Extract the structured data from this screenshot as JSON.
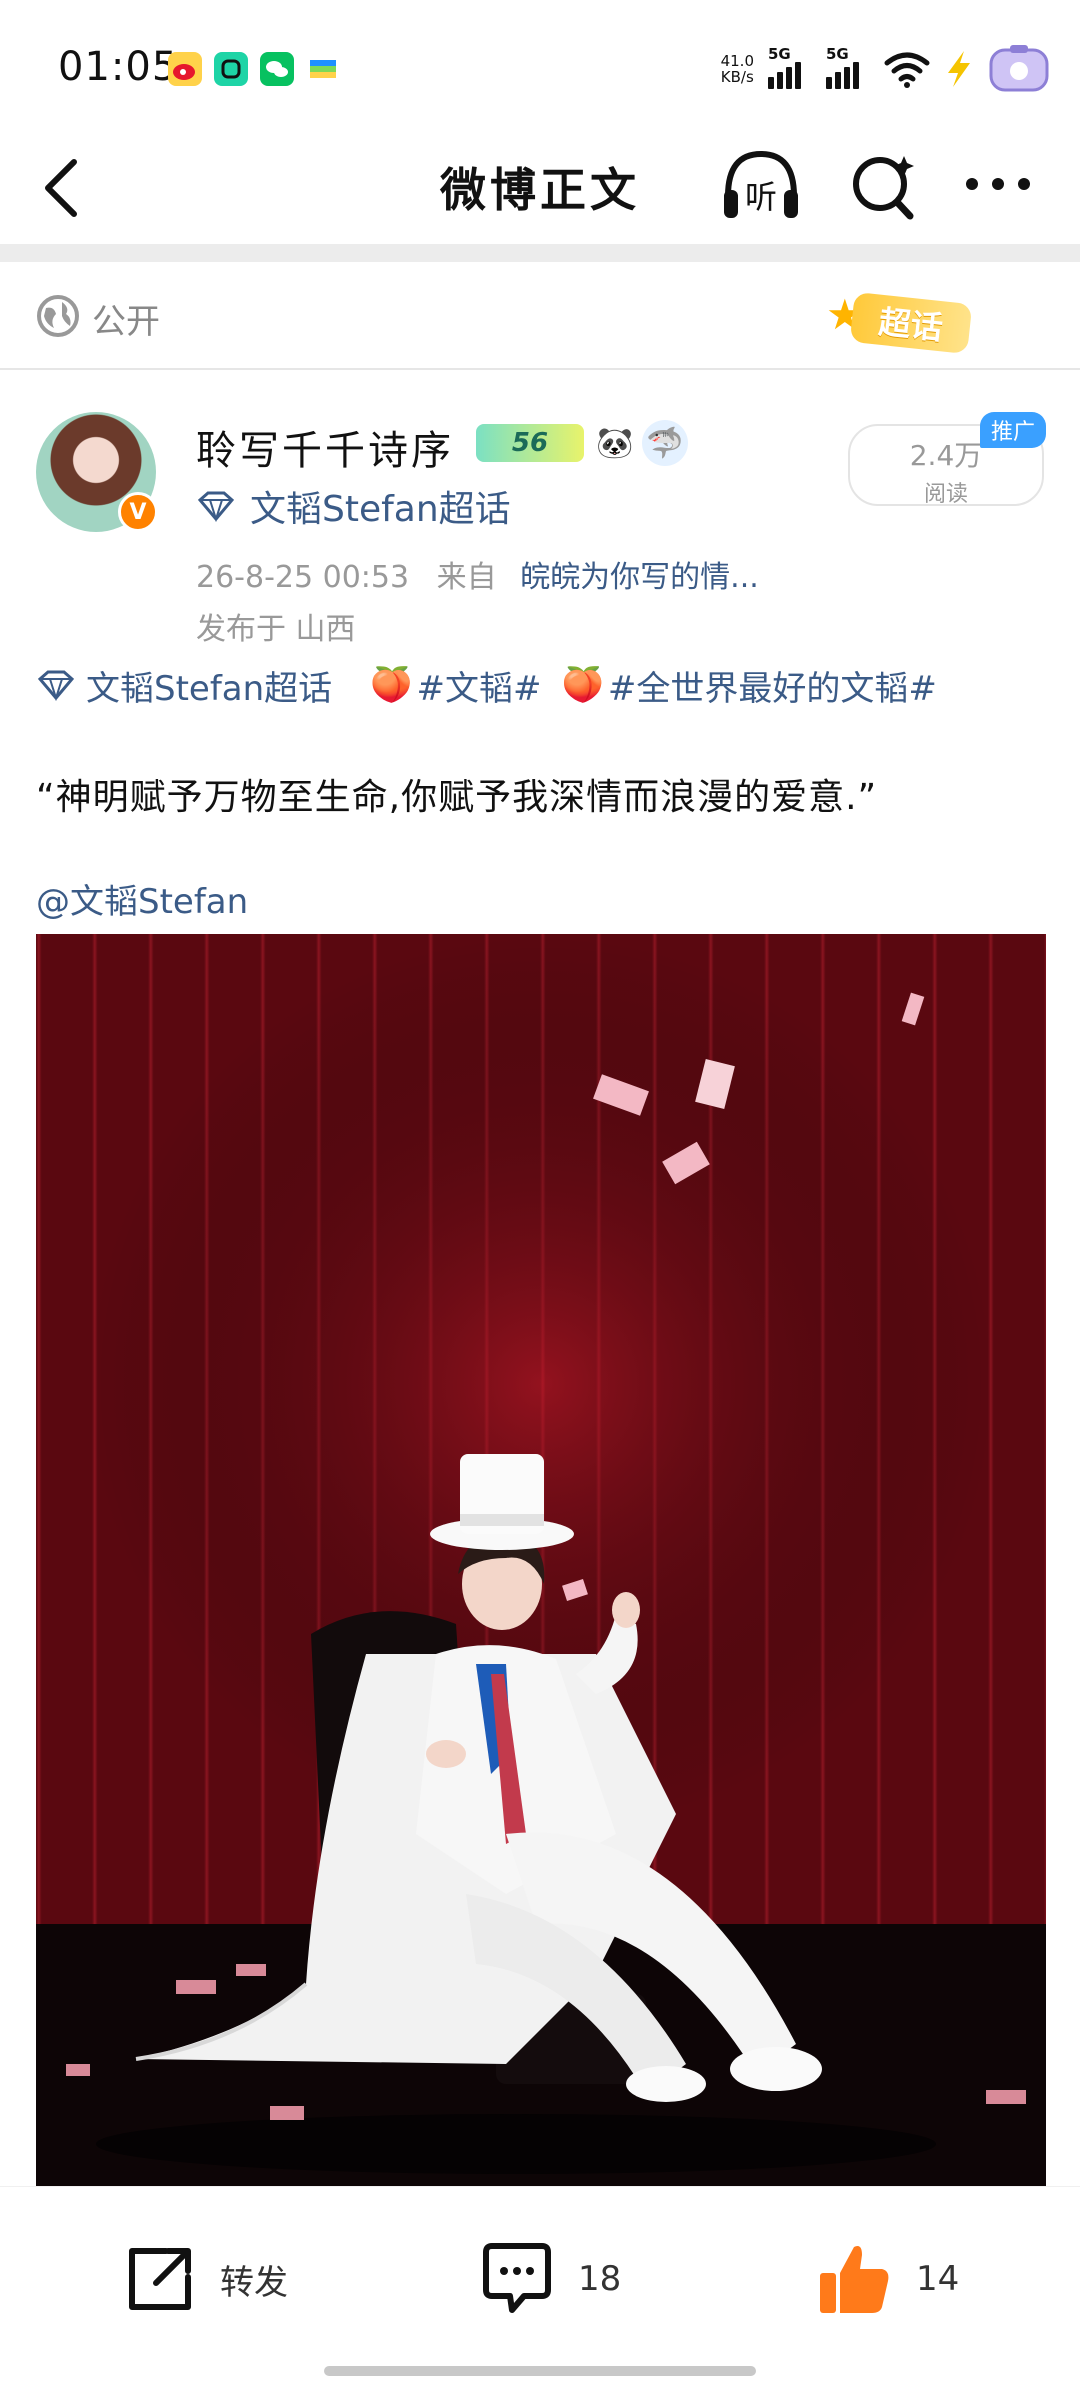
{
  "status_bar": {
    "time": "01:05",
    "net_speed_value": "41.0",
    "net_speed_unit": "KB/s",
    "sim1": "5G",
    "sim2": "5G",
    "icons": [
      "weibo-icon",
      "app-icon",
      "wechat-icon",
      "wallet-icon",
      "wifi-icon",
      "charging-icon",
      "battery-icon"
    ]
  },
  "nav": {
    "title": "微博正文",
    "listen_label": "听"
  },
  "visibility": {
    "label": "公开",
    "super_topic_badge": "超话"
  },
  "author": {
    "name": "聆写千千诗序",
    "level": "56",
    "topic": "文韬Stefan超话",
    "timestamp": "26-8-25 00:53",
    "from_label": "来自",
    "source": "皖皖为你写的情...",
    "location": "发布于 山西",
    "views_value": "2.4万",
    "views_label": "阅读",
    "promo_tag": "推广"
  },
  "tags": {
    "super_topic": "文韬Stefan超话",
    "tag1": "#文韬#",
    "tag2": "#全世界最好的文韬#"
  },
  "post": {
    "text": "“神明赋予万物至生命,你赋予我深情而浪漫的爱意.”",
    "mention": "@文韬Stefan"
  },
  "actions": {
    "repost_label": "转发",
    "comment_count": "18",
    "like_count": "14"
  },
  "colors": {
    "link_blue": "#3b5b87",
    "like_orange": "#ff7a1a",
    "curtain_red": "#7a0d16"
  }
}
